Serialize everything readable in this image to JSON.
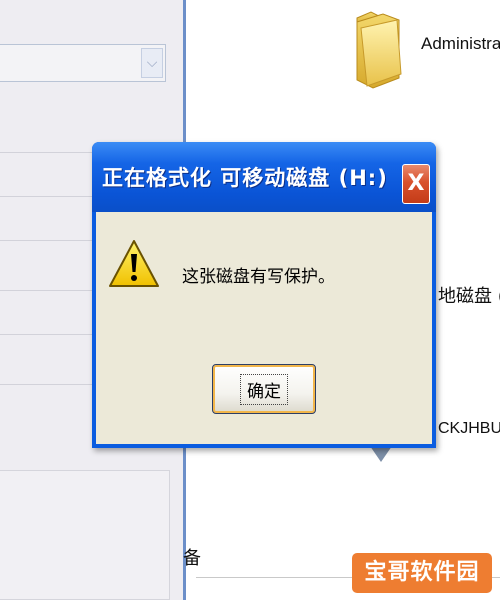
{
  "dialog": {
    "title": "正在格式化 可移动磁盘 (H:)",
    "close_label": "X",
    "message": "这张磁盘有写保护。",
    "ok_label": "确定",
    "icon": "warning-icon"
  },
  "explorer": {
    "folder_label": "Administrato",
    "folder_icon": "folder-icon",
    "partial_text_1": "地磁盘 (",
    "partial_text_2": "CKJHBUF",
    "partial_text_3": "备"
  },
  "left_pane": {
    "combo_arrow": "⌵"
  },
  "watermark": {
    "text": "宝哥软件园"
  },
  "colors": {
    "titlebar": "#0a54d6",
    "dialog_body": "#ece9d8",
    "close_button": "#d9512c",
    "watermark": "#ee7d31",
    "pane_border": "#6c8fc9"
  }
}
